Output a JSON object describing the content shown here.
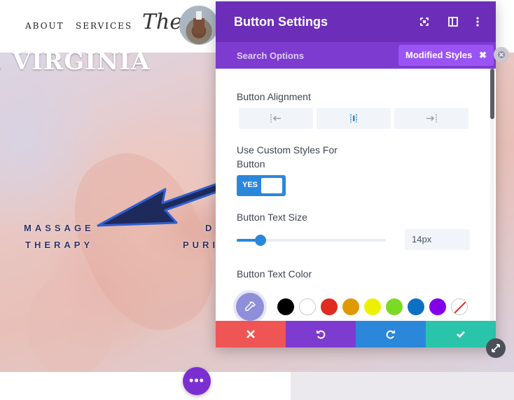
{
  "nav": {
    "about": "ABOUT",
    "services": "SERVICES",
    "logo_text": "The"
  },
  "hero": {
    "heading": ", VIRGINIA",
    "service_left_line1": "MASSAGE",
    "service_left_line2": "THERAPY",
    "service_right_line1": "D",
    "service_right_line2": "PURI"
  },
  "page_menu": {
    "label": "•••"
  },
  "panel": {
    "title": "Button Settings",
    "header_icons": [
      "fullscreen-icon",
      "sidebar-toggle-icon",
      "more-vertical-icon"
    ],
    "tabs": {
      "search": "Search Options",
      "modified": "Modified Styles",
      "modified_close": "✖"
    },
    "fields": {
      "alignment_label": "Button Alignment",
      "alignment_options": [
        "align-left-icon",
        "align-center-icon",
        "align-right-icon"
      ],
      "custom_styles_label_line1": "Use Custom Styles For",
      "custom_styles_label_line2": "Button",
      "custom_styles_toggle": "YES",
      "text_size_label": "Button Text Size",
      "text_size_value": "14px",
      "text_size_fraction": 0.16,
      "text_color_label": "Button Text Color"
    },
    "swatches": [
      "#000000",
      "#ffffff",
      "#e02b20",
      "#e09900",
      "#edf000",
      "#7cda24",
      "#0c71c3",
      "#8300e9",
      "none"
    ],
    "footer": [
      "cancel-icon",
      "undo-icon",
      "redo-icon",
      "save-check-icon"
    ]
  },
  "colors": {
    "header_purple": "#6c2eb9",
    "tab_purple": "#7e3bd0",
    "accent_blue": "#2b87da",
    "cancel_red": "#ef5555",
    "save_green": "#29c4a9"
  }
}
